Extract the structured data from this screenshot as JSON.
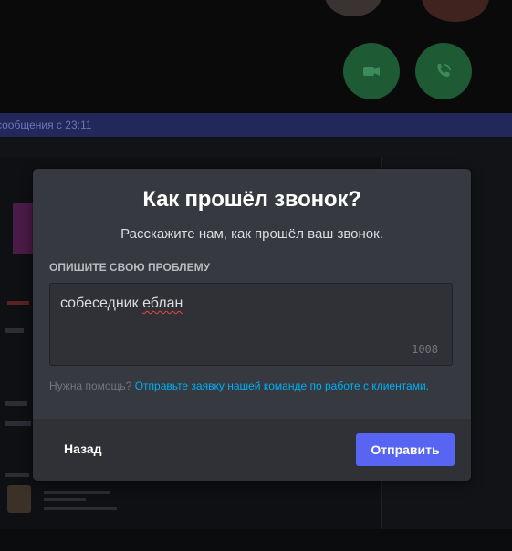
{
  "call": {
    "video_icon": "video-camera-icon",
    "phone_icon": "phone-call-icon"
  },
  "chat": {
    "new_messages_banner": "сообщения с 23:11"
  },
  "modal": {
    "title": "Как прошёл звонок?",
    "subtitle": "Расскажите нам, как прошёл ваш звонок.",
    "field_label": "ОПИШИТЕ СВОЮ ПРОБЛЕМУ",
    "field_value_word1": "собеседник",
    "field_value_word2": "еблан",
    "char_counter": "1008",
    "help_prefix": "Нужна помощь?",
    "help_link": "Отправьте заявку нашей команде по работе с клиентами.",
    "back_label": "Назад",
    "submit_label": "Отправить"
  },
  "colors": {
    "modal_bg": "#36393f",
    "footer_bg": "#2f3136",
    "accent": "#5865f2",
    "link": "#00aff4",
    "call_green": "#1e5b35"
  }
}
